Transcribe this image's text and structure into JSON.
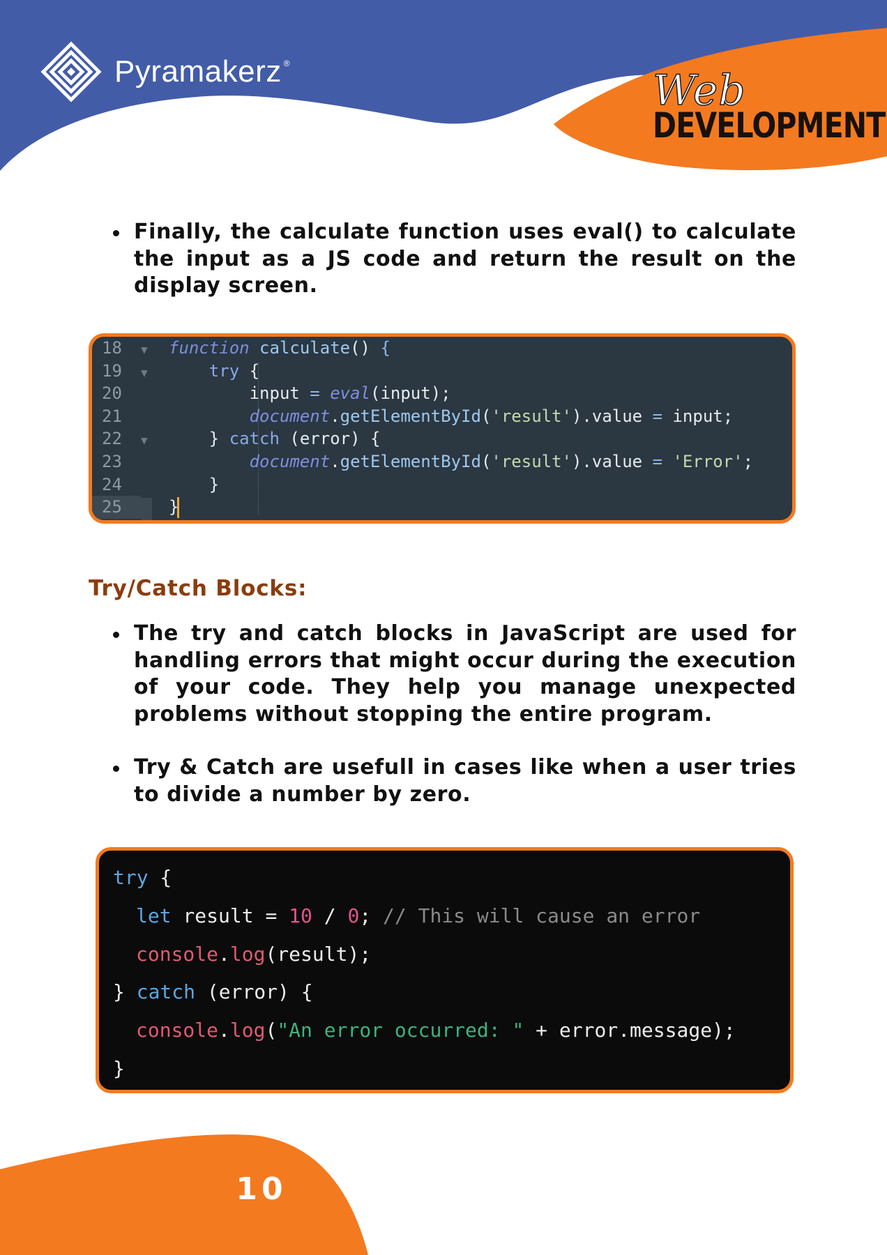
{
  "header": {
    "brand_name": "Pyramakerz",
    "brand_mark": "®",
    "badge_script": "Web",
    "badge_bold": "DEVELOPMENT"
  },
  "colors": {
    "header_blue": "#435ca8",
    "accent_orange": "#f47a20",
    "heading_brown": "#8a3d0f"
  },
  "icons": [
    "pyramakerz-logo-icon"
  ],
  "section1": {
    "bullet": "Finally, the calculate function uses eval() to calculate the input as a JS code and return the result on the display screen."
  },
  "code1": {
    "line_numbers": [
      "18",
      "19",
      "20",
      "21",
      "22",
      "23",
      "24",
      "25"
    ],
    "lines": [
      "function calculate() {",
      "    try {",
      "        input = eval(input);",
      "        document.getElementById('result').value = input;",
      "    } catch (error) {",
      "        document.getElementById('result').value = 'Error';",
      "    }",
      "}"
    ]
  },
  "section2": {
    "heading": "Try/Catch Blocks:",
    "bullets": [
      "The try and catch blocks in JavaScript are used for handling errors that might occur during the execution of your code. They help you manage unexpected problems without stopping the entire program.",
      "Try & Catch are usefull in cases like when a user tries to divide a number by zero."
    ]
  },
  "code2": {
    "lines": [
      "try {",
      "let result = 10 / 0; // This will cause an error",
      "console.log(result);",
      "} catch (error) {",
      "console.log(\"An error occurred: \" + error.message);",
      "}"
    ]
  },
  "footer": {
    "page_number": "10"
  }
}
